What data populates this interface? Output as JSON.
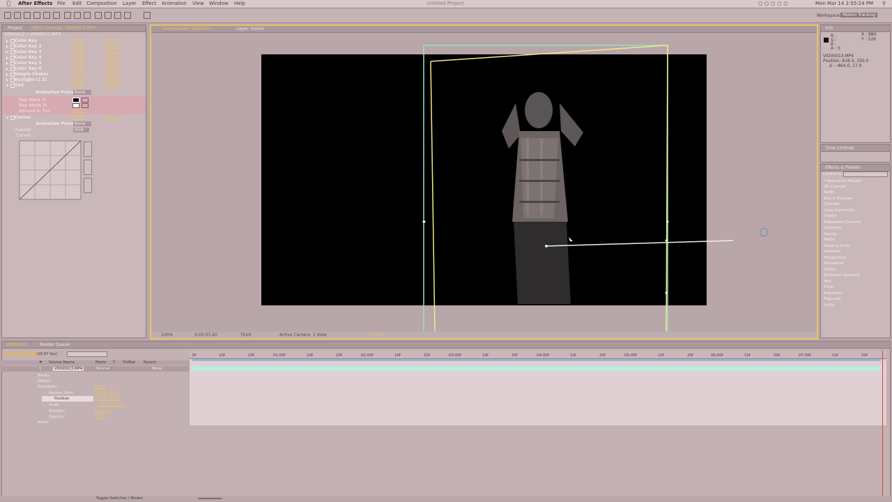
{
  "app": {
    "menu": [
      "After Effects",
      "File",
      "Edit",
      "Composition",
      "Layer",
      "Effect",
      "Animation",
      "View",
      "Window",
      "Help"
    ],
    "window_title": "Untitled Project",
    "clock": "Mon Mar 14  2:55:24 PM",
    "workspace_label": "Workspace:",
    "workspace_value": "Motion Tracking"
  },
  "left_panel": {
    "tabs": [
      "Project",
      "Effect Controls: VID00013.MP4"
    ],
    "breadcrumb": "VID00013 • VID00013.MP4",
    "effects": [
      {
        "name": "Color Key",
        "reset": "Reset",
        "about": "About..."
      },
      {
        "name": "Color Key 2",
        "reset": "Reset",
        "about": "About..."
      },
      {
        "name": "Color Key 3",
        "reset": "Reset",
        "about": "About..."
      },
      {
        "name": "Color Key 4",
        "reset": "Reset",
        "about": "About..."
      },
      {
        "name": "Color Key 5",
        "reset": "Reset",
        "about": "About..."
      },
      {
        "name": "Color Key 6",
        "reset": "Reset",
        "about": "About..."
      },
      {
        "name": "Simple Choker",
        "reset": "Reset",
        "about": "About..."
      },
      {
        "name": "Keylight (1.2)",
        "reset": "Reset",
        "about": "About..."
      },
      {
        "name": "Tint",
        "reset": "Reset",
        "about": "About..."
      }
    ],
    "animation_presets_label": "Animation Presets:",
    "animation_presets_value": "None",
    "tint_props": [
      "Map Black To",
      "Map White To",
      "Amount to Tint"
    ],
    "tint_amount": "100.0%",
    "curves_name": "Curves",
    "curves_reset": "Reset",
    "curves_about": "About...",
    "channel_label": "Channel:",
    "channel_value": "RGB",
    "curves_sub": "Curves"
  },
  "comp_panel": {
    "tabs": [
      "Composition: VID00013",
      "Layer: (none)"
    ],
    "zoom": "100%",
    "timecode": "0;00;07;20",
    "resolution": "Third",
    "camera": "Active Camera",
    "view": "1 View",
    "exposure": "+0.0"
  },
  "info_panel": {
    "tab": "Info",
    "r": "R :",
    "g": "G :",
    "b": "B :",
    "a": "A : 0",
    "x": "X : 880",
    "y": "Y : 526",
    "layer": "VID00013.MP4",
    "position": "Position: 818.0, 350.0",
    "delta": "Δ : -864.0, 17.0"
  },
  "time_controls": {
    "tab": "Time Controls"
  },
  "effects_presets": {
    "tab": "Effects & Presets",
    "contains": "Contains:",
    "categories": [
      "* Animation Presets",
      "3D Channel",
      "Audio",
      "Blur & Sharpen",
      "Channel",
      "Color Correction",
      "Distort",
      "Expression Controls",
      "Generate",
      "Keying",
      "Matte",
      "Noise & Grain",
      "Obsolete",
      "Perspective",
      "Simulation",
      "Stylize",
      "Synthetic Aperture",
      "Text",
      "Time",
      "Transition",
      "Trapcode",
      "Utility"
    ]
  },
  "timeline": {
    "tabs": [
      "VID00013",
      "Render Queue"
    ],
    "timecode": "0;00;07;20",
    "fps": "(29.97 fps)",
    "columns": [
      "#",
      "Source Name",
      "Mode",
      "T",
      "TrkMat",
      "Parent"
    ],
    "layer": {
      "num": "1",
      "name": "VID00013.MP4",
      "mode": "Normal",
      "parent": "None"
    },
    "props": [
      "Masks",
      "Effects",
      "Transform",
      "Anchor Point",
      "Position",
      "Scale",
      "Rotation",
      "Opacity",
      "Audio"
    ],
    "transform_reset": "Reset",
    "values": {
      "anchor": "960.0, 540.0",
      "position": "818.0, 350.0",
      "scale": "100.0, 100.0%",
      "rotation": "0x +0.0°",
      "opacity": "100%"
    },
    "ruler": [
      "0f",
      "10f",
      "20f",
      "01:00f",
      "10f",
      "20f",
      "02:00f",
      "10f",
      "20f",
      "03:00f",
      "10f",
      "20f",
      "04:00f",
      "10f",
      "20f",
      "05:00f",
      "10f",
      "20f",
      "06:00f",
      "10f",
      "20f",
      "07:00f",
      "10f",
      "20f"
    ],
    "toggle": "Toggle Switches / Modes"
  }
}
